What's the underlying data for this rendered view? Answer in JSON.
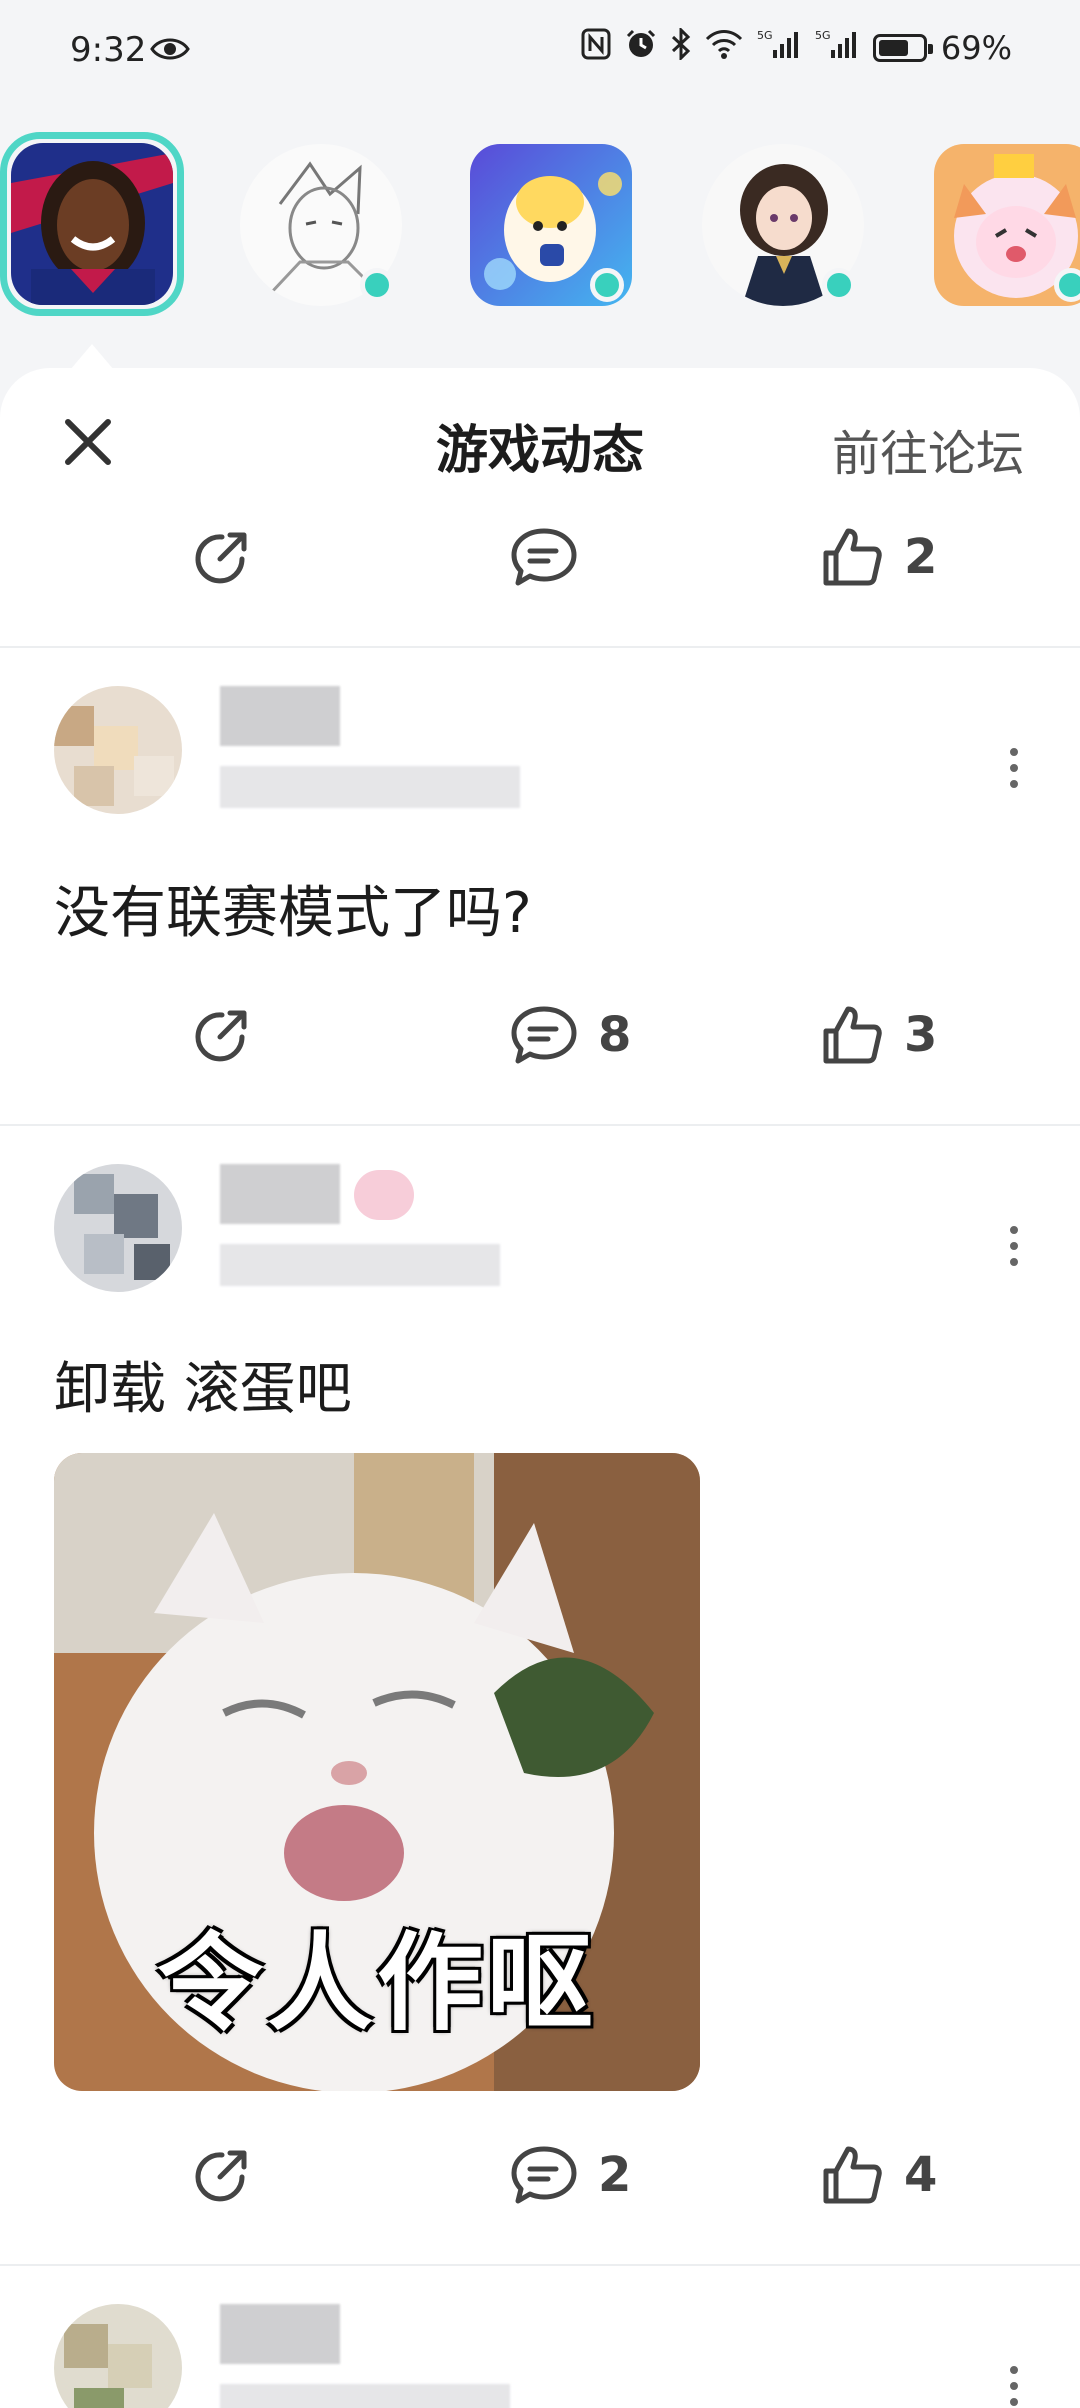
{
  "status_bar": {
    "time": "9:32",
    "battery": "69%",
    "battery_level": 0.69,
    "icons": [
      "eye-icon",
      "nfc-icon",
      "alarm-icon",
      "bluetooth-icon",
      "wifi-icon",
      "signal-5g-icon",
      "signal-5g-icon",
      "battery-icon"
    ]
  },
  "avatar_strip": {
    "items": [
      {
        "name": "selected-game-avatar",
        "selected": true,
        "online": false
      },
      {
        "name": "sketch-avatar",
        "selected": false,
        "online": true
      },
      {
        "name": "eggy-avatar",
        "selected": false,
        "online": true
      },
      {
        "name": "anime-girl-avatar",
        "selected": false,
        "online": true
      },
      {
        "name": "cat-hood-avatar",
        "selected": false,
        "online": true
      }
    ],
    "accent_color": "#4fd6c6"
  },
  "sheet": {
    "title": "游戏动态",
    "forum_link": "前往论坛",
    "close_icon": "close-icon"
  },
  "posts": [
    {
      "text": "",
      "actions": {
        "comments": "",
        "likes": "2"
      }
    },
    {
      "text": "没有联赛模式了吗?",
      "actions": {
        "comments": "8",
        "likes": "3"
      }
    },
    {
      "text": "卸载 滚蛋吧",
      "image_caption": "令人作呕",
      "actions": {
        "comments": "2",
        "likes": "4"
      }
    }
  ]
}
